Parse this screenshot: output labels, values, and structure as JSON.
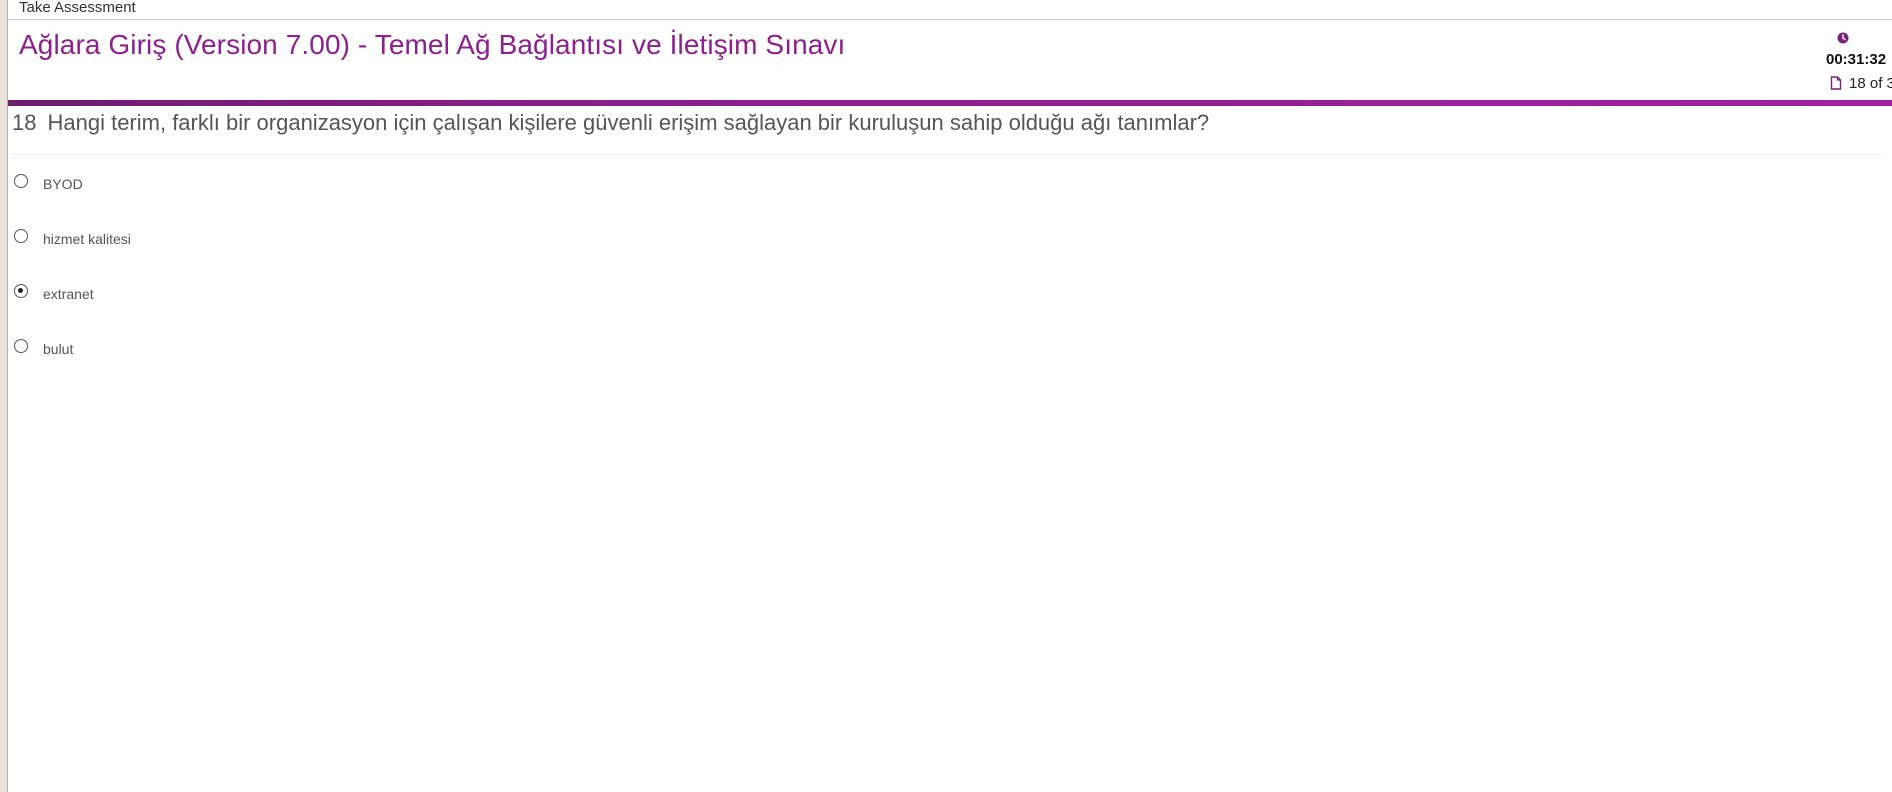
{
  "window": {
    "title": "Take Assessment"
  },
  "exam": {
    "title": "Ağlara Giriş (Version 7.00) - Temel Ağ Bağlantısı ve İletişim Sınavı"
  },
  "timer": {
    "icon": "clock-icon",
    "value": "00:31:32"
  },
  "progress": {
    "icon": "page-icon",
    "text": "18 of 3"
  },
  "question": {
    "number": "18",
    "text": "Hangi terim, farklı bir organizasyon için çalışan kişilere güvenli erişim sağlayan bir kuruluşun sahip olduğu ağı tanımlar?"
  },
  "options": [
    {
      "label": "BYOD",
      "selected": false
    },
    {
      "label": "hizmet kalitesi",
      "selected": false
    },
    {
      "label": "extranet",
      "selected": true
    },
    {
      "label": "bulut",
      "selected": false
    }
  ],
  "colors": {
    "accent": "#8e1f8e",
    "accent_bar": "#8b1d8b"
  }
}
